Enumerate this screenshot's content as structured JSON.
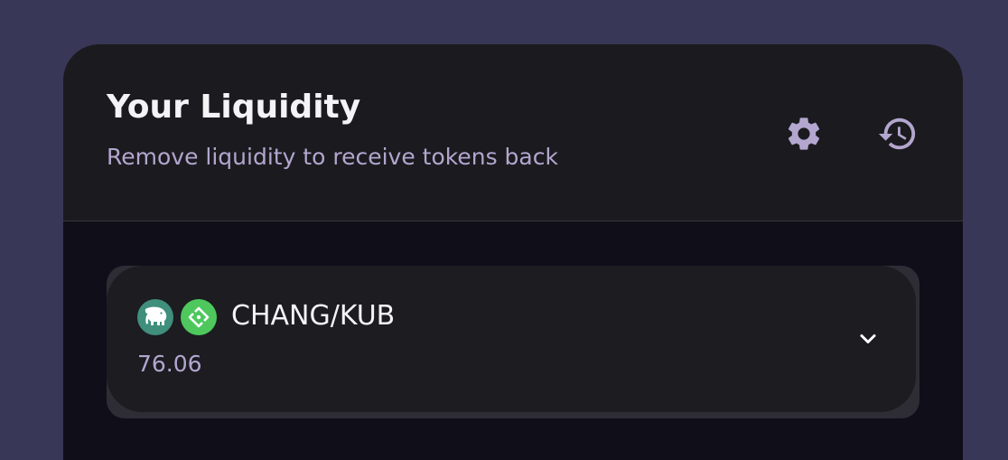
{
  "colors": {
    "background": "#383757",
    "card": "#1b1b1f",
    "body": "#100e18",
    "pool": "#1c1c21",
    "accent": "#b3a6cf",
    "title": "#f4f4f6"
  },
  "header": {
    "title": "Your Liquidity",
    "subtitle": "Remove liquidity to receive tokens back",
    "icons": [
      "settings-icon",
      "history-icon"
    ]
  },
  "pool": {
    "pair": "CHANG/KUB",
    "value": "76.06",
    "tokens": [
      {
        "symbol": "CHANG",
        "icon": "elephant-icon",
        "color": "#3f8f7c"
      },
      {
        "symbol": "KUB",
        "icon": "bitkub-icon",
        "color": "#4ec85d"
      }
    ],
    "toggle_icon": "chevron-down-icon"
  }
}
